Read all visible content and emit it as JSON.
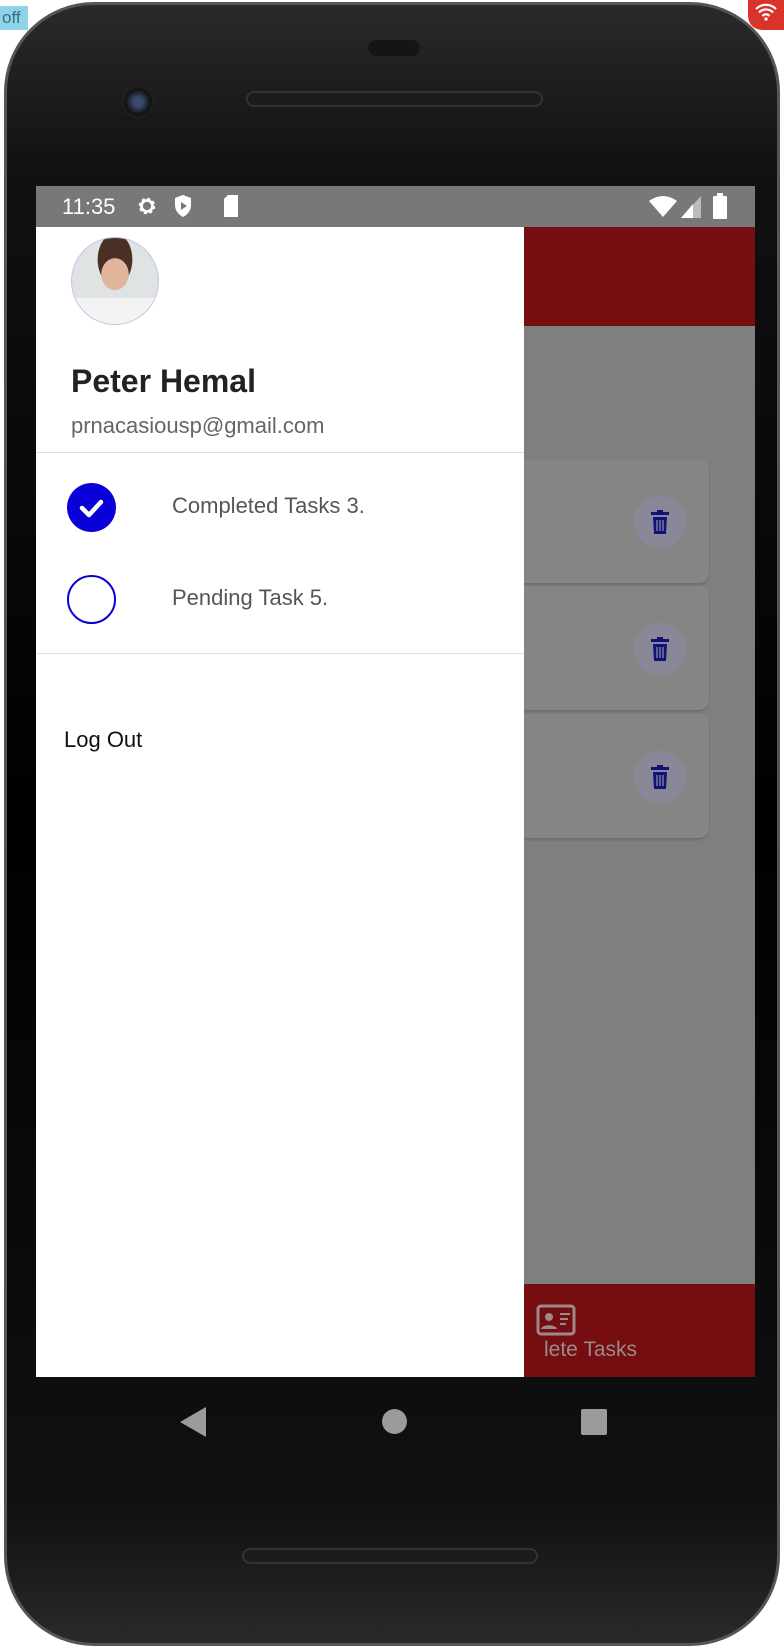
{
  "status_bar": {
    "time": "11:35",
    "icons": [
      "gear-icon",
      "shield-play-icon",
      "sd-card-icon",
      "wifi-icon",
      "signal-icon",
      "battery-icon"
    ]
  },
  "drawer": {
    "user": {
      "name": "Peter Hemal",
      "email": "prnacasiousp@gmail.com"
    },
    "items": [
      {
        "label": "Completed Tasks 3.",
        "icon": "check-circle-icon",
        "checked": true
      },
      {
        "label": "Pending Task 5.",
        "icon": "empty-circle-icon",
        "checked": false
      }
    ],
    "logout_label": "Log Out"
  },
  "background": {
    "bottom_nav_label": "lete Tasks",
    "card_icon": "trash-icon",
    "card_count": 3
  },
  "colors": {
    "accent": "#0a00d8",
    "app_bar": "#760e11",
    "status_bar": "#787878"
  },
  "emulator": {
    "corner_tag": "off"
  }
}
